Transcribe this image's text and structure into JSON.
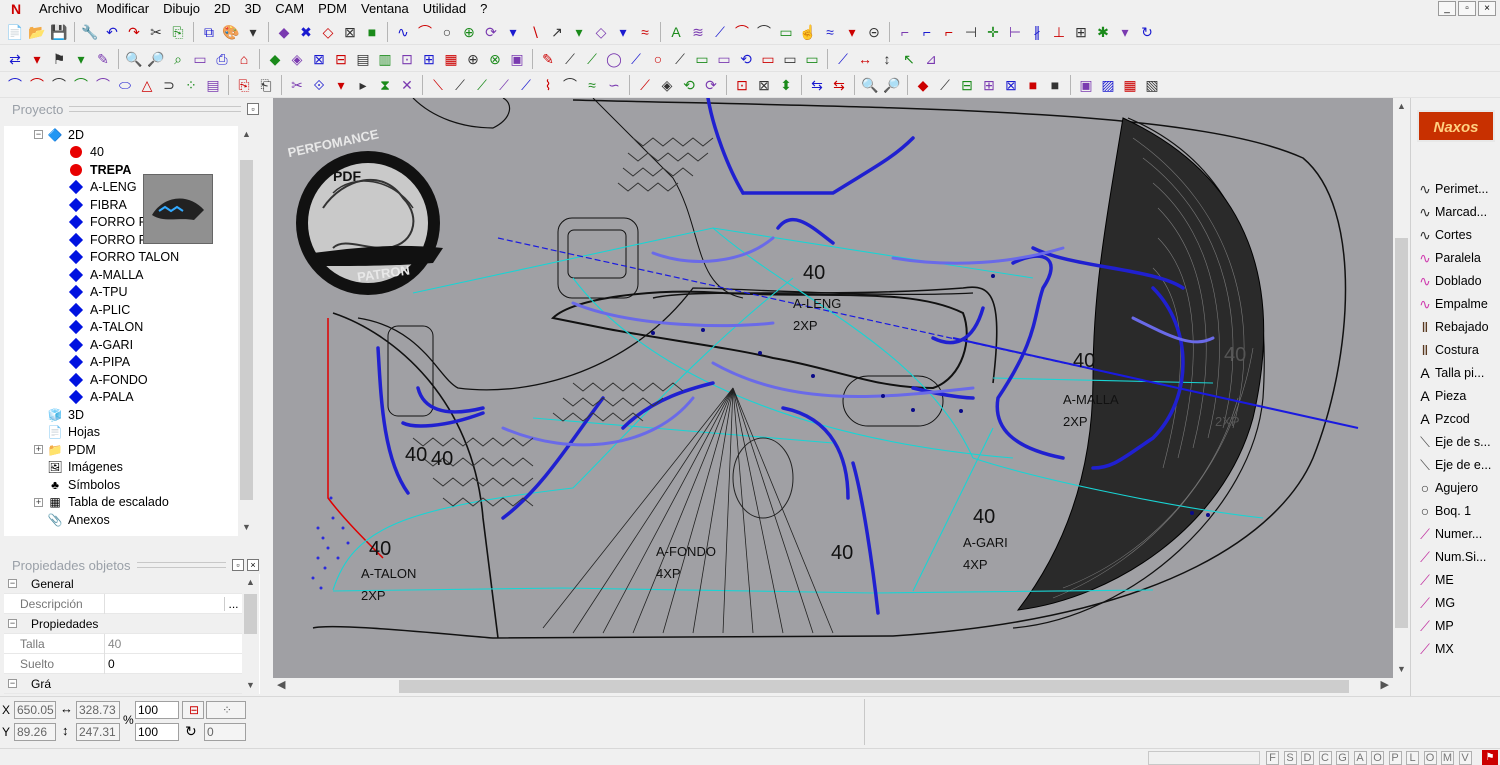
{
  "menubar": {
    "items": [
      "Archivo",
      "Modificar",
      "Dibujo",
      "2D",
      "3D",
      "CAM",
      "PDM",
      "Ventana",
      "Utilidad",
      "?"
    ],
    "window_controls": [
      "_",
      "▫",
      "×"
    ]
  },
  "project_panel": {
    "title": "Proyecto",
    "tree": [
      {
        "label": "2D",
        "icon": "folder-diamond-icon",
        "level": 1,
        "expander": "−"
      },
      {
        "label": "40",
        "icon": "red-dot",
        "level": 2
      },
      {
        "label": "TREPA",
        "icon": "red-dot",
        "level": 2,
        "bold": true
      },
      {
        "label": "A-LENG",
        "icon": "blue-diamond",
        "level": 2
      },
      {
        "label": "FIBRA",
        "icon": "blue-diamond",
        "level": 2
      },
      {
        "label": "FORRO P",
        "icon": "blue-diamond",
        "level": 2
      },
      {
        "label": "FORRO PALA",
        "icon": "blue-diamond",
        "level": 2
      },
      {
        "label": "FORRO TALON",
        "icon": "blue-diamond",
        "level": 2
      },
      {
        "label": "A-MALLA",
        "icon": "blue-diamond",
        "level": 2
      },
      {
        "label": "A-TPU",
        "icon": "blue-diamond",
        "level": 2
      },
      {
        "label": "A-PLIC",
        "icon": "blue-diamond",
        "level": 2
      },
      {
        "label": "A-TALON",
        "icon": "blue-diamond",
        "level": 2
      },
      {
        "label": "A-GARI",
        "icon": "blue-diamond",
        "level": 2
      },
      {
        "label": "A-PIPA",
        "icon": "blue-diamond",
        "level": 2
      },
      {
        "label": "A-FONDO",
        "icon": "blue-diamond",
        "level": 2
      },
      {
        "label": "A-PALA",
        "icon": "blue-diamond",
        "level": 2
      },
      {
        "label": "3D",
        "icon": "folder-3d-icon",
        "level": 1
      },
      {
        "label": "Hojas",
        "icon": "sheets-icon",
        "level": 1
      },
      {
        "label": "PDM",
        "icon": "pdm-icon",
        "level": 1,
        "expander": "+"
      },
      {
        "label": "Imágenes",
        "icon": "images-icon",
        "level": 1
      },
      {
        "label": "Símbolos",
        "icon": "symbols-icon",
        "level": 1
      },
      {
        "label": "Tabla de escalado",
        "icon": "table-icon",
        "level": 1,
        "expander": "+"
      },
      {
        "label": "Anexos",
        "icon": "attachment-icon",
        "level": 1
      }
    ]
  },
  "properties_panel": {
    "title": "Propiedades objetos",
    "rows": [
      {
        "type": "group",
        "label": "General"
      },
      {
        "type": "prop",
        "name": "Descripción",
        "value": "",
        "button": "..."
      },
      {
        "type": "group",
        "label": "Propiedades"
      },
      {
        "type": "prop",
        "name": "Talla",
        "value": "40"
      },
      {
        "type": "prop",
        "name": "Suelto",
        "value": "0"
      },
      {
        "type": "group",
        "label": "Grá"
      }
    ]
  },
  "canvas": {
    "watermark": {
      "top": "PERFOMANCE",
      "middle": "PDF",
      "bottom": "PATRON"
    },
    "pieces": [
      {
        "size": "40",
        "name": "A-LENG",
        "qty": "2XP"
      },
      {
        "size": "40",
        "name": "A-MALLA",
        "qty": "2XP"
      },
      {
        "size": "40",
        "name": "A-TALON",
        "qty": "2XP"
      },
      {
        "size": "40",
        "name": "A-FONDO",
        "qty": "4XP"
      },
      {
        "size": "40",
        "name": "A-GARI",
        "qty": "4XP"
      }
    ],
    "extra_labels": [
      "40",
      "40",
      "40",
      "40",
      "2XP"
    ]
  },
  "right_panel": {
    "logo": "Naxos",
    "items": [
      {
        "label": "Perimet...",
        "icon": "curve-icon"
      },
      {
        "label": "Marcad...",
        "icon": "curve-icon"
      },
      {
        "label": "Cortes",
        "icon": "curve-icon"
      },
      {
        "label": "Paralela",
        "icon": "pink-curve-icon"
      },
      {
        "label": "Doblado",
        "icon": "pink-curve-icon"
      },
      {
        "label": "Empalme",
        "icon": "pink-curve-icon"
      },
      {
        "label": "Rebajado",
        "icon": "stitch-icon"
      },
      {
        "label": "Costura",
        "icon": "stitch-icon"
      },
      {
        "label": "Talla pi...",
        "icon": "text-icon"
      },
      {
        "label": "Pieza",
        "icon": "text-icon"
      },
      {
        "label": "Pzcod",
        "icon": "text-icon"
      },
      {
        "label": "Eje de s...",
        "icon": "axis-icon"
      },
      {
        "label": "Eje de e...",
        "icon": "axis-icon"
      },
      {
        "label": "Agujero",
        "icon": "circle-icon"
      },
      {
        "label": "Boq. 1",
        "icon": "circle-icon"
      },
      {
        "label": "Numer...",
        "icon": "pink-pen-icon"
      },
      {
        "label": "Num.Si...",
        "icon": "pink-pen-icon"
      },
      {
        "label": "ME",
        "icon": "pink-pen-icon"
      },
      {
        "label": "MG",
        "icon": "pink-pen-icon"
      },
      {
        "label": "MP",
        "icon": "pink-pen-icon"
      },
      {
        "label": "MX",
        "icon": "pink-pen-icon"
      }
    ]
  },
  "coords": {
    "x_label": "X",
    "y_label": "Y",
    "x": "650.05",
    "y": "89.26",
    "width": "328.73",
    "height": "247.31",
    "scale_x": "100",
    "scale_y": "100",
    "rot": "0",
    "percent": "%"
  },
  "status_keys": [
    "F",
    "S",
    "D",
    "C",
    "G",
    "A",
    "O",
    "P",
    "L",
    "O",
    "M",
    "V"
  ]
}
